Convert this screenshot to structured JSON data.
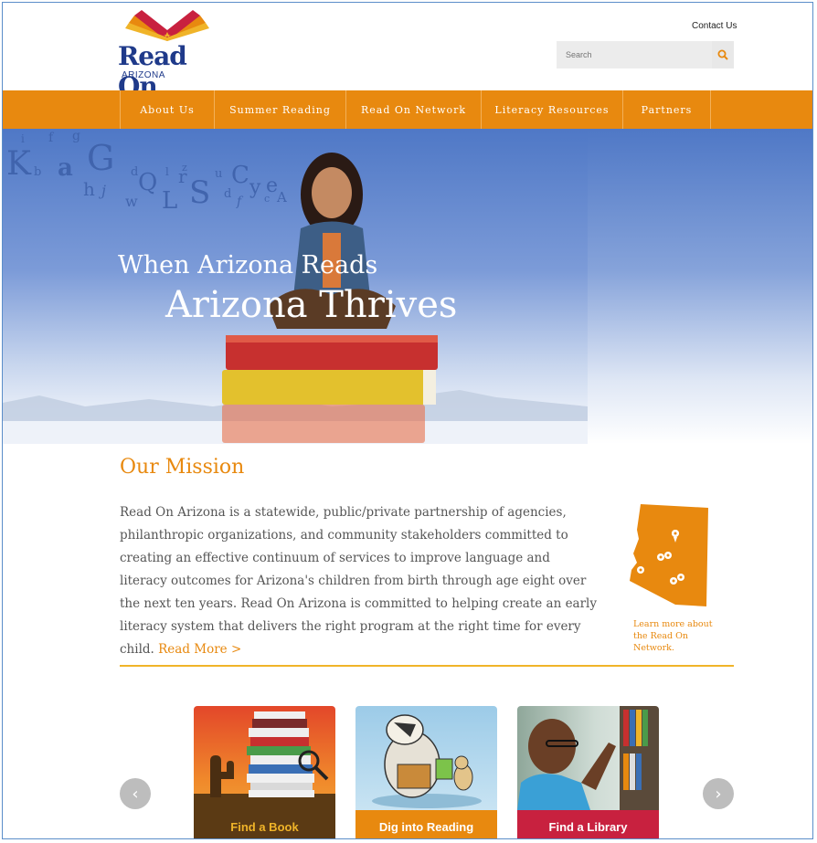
{
  "header": {
    "logo_main": "Read On",
    "logo_sub": "ARIZONA",
    "contact_label": "Contact Us",
    "search_placeholder": "Search"
  },
  "nav": {
    "items": [
      {
        "label": "About Us"
      },
      {
        "label": "Summer Reading"
      },
      {
        "label": "Read On Network"
      },
      {
        "label": "Literacy Resources"
      },
      {
        "label": "Partners"
      }
    ]
  },
  "hero": {
    "line1": "When Arizona Reads",
    "line2": "Arizona Thrives"
  },
  "mission": {
    "title": "Our Mission",
    "body": "Read On Arizona is a statewide, public/private partnership of agencies, philanthropic organizations, and community stakeholders committed to creating an effective continuum of services to improve language and literacy outcomes for Arizona's children from birth through age eight over the next ten years. Read On Arizona is committed to helping create an early literacy system that delivers the right program at the right time for every child.",
    "read_more": "Read More >",
    "map_caption": "Learn more about the Read On Network."
  },
  "tiles": [
    {
      "label": "Find a Book",
      "color": "#5b3a14"
    },
    {
      "label": "Dig into Reading",
      "color": "#e8890f"
    },
    {
      "label": "Find a Library",
      "color": "#c8213f"
    }
  ],
  "colors": {
    "accent": "#e8890f",
    "brand_blue": "#1f3a8a",
    "divider": "#f0b429"
  }
}
